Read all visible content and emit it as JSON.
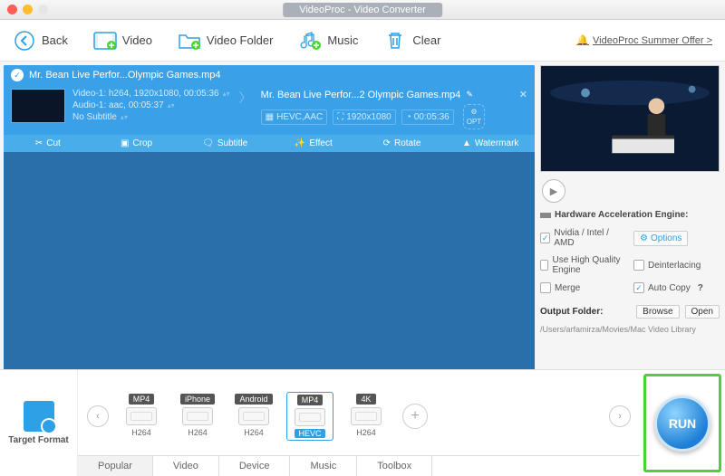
{
  "window": {
    "title": "VideoProc - Video Converter"
  },
  "toolbar": {
    "back": "Back",
    "video": "Video",
    "video_folder": "Video Folder",
    "music": "Music",
    "clear": "Clear",
    "offer": "VideoProc Summer Offer >"
  },
  "queue_item": {
    "source_title": "Mr. Bean Live Perfor...Olympic Games.mp4",
    "video_track": "Video-1: h264, 1920x1080, 00:05:36",
    "audio_track": "Audio-1: aac, 00:05:37",
    "subtitle_track": "No Subtitle",
    "output_title": "Mr. Bean Live Perfor...2 Olympic Games.mp4",
    "output_codec": "HEVC,AAC",
    "output_res": "1920x1080",
    "output_dur": "00:05:36",
    "opt_label": "OPT"
  },
  "edit_strip": {
    "cut": "Cut",
    "crop": "Crop",
    "subtitle": "Subtitle",
    "effect": "Effect",
    "rotate": "Rotate",
    "watermark": "Watermark"
  },
  "hw": {
    "title": "Hardware Acceleration Engine:",
    "nvidia": "Nvidia / Intel / AMD",
    "options": "Options",
    "hq": "Use High Quality Engine",
    "deint": "Deinterlacing",
    "merge": "Merge",
    "auto_copy": "Auto Copy"
  },
  "output": {
    "label": "Output Folder:",
    "browse": "Browse",
    "open": "Open",
    "path": "/Users/arfamirza/Movies/Mac Video Library"
  },
  "target": {
    "label": "Target Format"
  },
  "formats": [
    {
      "top": "MP4",
      "bottom": "H264"
    },
    {
      "top": "iPhone",
      "bottom": "H264"
    },
    {
      "top": "Android",
      "bottom": "H264"
    },
    {
      "top": "MP4",
      "bottom": "HEVC"
    },
    {
      "top": "4K",
      "bottom": "H264"
    }
  ],
  "tabs": [
    "Popular",
    "Video",
    "Device",
    "Music",
    "Toolbox"
  ],
  "run": "RUN"
}
